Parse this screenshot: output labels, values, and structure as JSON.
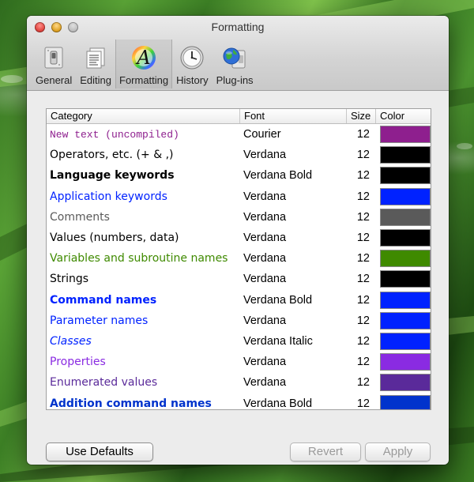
{
  "window": {
    "title": "Formatting",
    "traffic_lights": [
      "close",
      "minimize",
      "zoom"
    ]
  },
  "toolbar": {
    "items": [
      {
        "label": "General",
        "icon": "switch-icon",
        "selected": false
      },
      {
        "label": "Editing",
        "icon": "document-icon",
        "selected": false
      },
      {
        "label": "Formatting",
        "icon": "font-a-icon",
        "selected": true
      },
      {
        "label": "History",
        "icon": "clock-icon",
        "selected": false
      },
      {
        "label": "Plug-ins",
        "icon": "globe-plugin-icon",
        "selected": false
      }
    ]
  },
  "table": {
    "headers": {
      "category": "Category",
      "font": "Font",
      "size": "Size",
      "color": "Color"
    },
    "rows": [
      {
        "category": "New text (uncompiled)",
        "font": "Courier",
        "size": "12",
        "color": "#8e1f8e"
      },
      {
        "category": "Operators, etc. (+ & ,)",
        "font": "Verdana",
        "size": "12",
        "color": "#000000"
      },
      {
        "category": "Language keywords",
        "font": "Verdana Bold",
        "size": "12",
        "color": "#000000"
      },
      {
        "category": "Application keywords",
        "font": "Verdana",
        "size": "12",
        "color": "#0022ff"
      },
      {
        "category": "Comments",
        "font": "Verdana",
        "size": "12",
        "color": "#5a5a5a"
      },
      {
        "category": "Values (numbers, data)",
        "font": "Verdana",
        "size": "12",
        "color": "#000000"
      },
      {
        "category": "Variables and subroutine names",
        "font": "Verdana",
        "size": "12",
        "color": "#3f8a00"
      },
      {
        "category": "Strings",
        "font": "Verdana",
        "size": "12",
        "color": "#000000"
      },
      {
        "category": "Command names",
        "font": "Verdana Bold",
        "size": "12",
        "color": "#0022ff"
      },
      {
        "category": "Parameter names",
        "font": "Verdana",
        "size": "12",
        "color": "#0022ff"
      },
      {
        "category": "Classes",
        "font": "Verdana Italic",
        "size": "12",
        "color": "#0022ff"
      },
      {
        "category": "Properties",
        "font": "Verdana",
        "size": "12",
        "color": "#8a2be2"
      },
      {
        "category": "Enumerated values",
        "font": "Verdana",
        "size": "12",
        "color": "#5a2a9a"
      },
      {
        "category": "Addition command names",
        "font": "Verdana Bold",
        "size": "12",
        "color": "#0033cc"
      }
    ]
  },
  "buttons": {
    "use_defaults": "Use Defaults",
    "revert": "Revert",
    "apply": "Apply"
  }
}
